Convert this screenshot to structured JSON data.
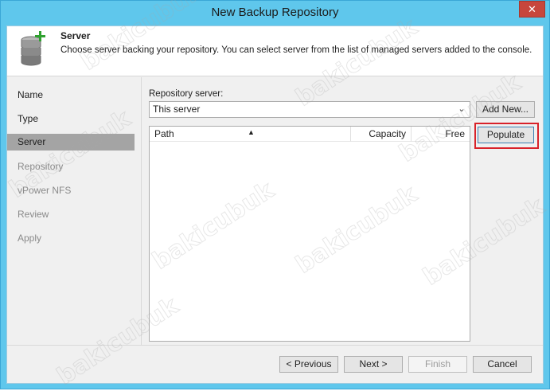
{
  "window": {
    "title": "New Backup Repository",
    "close_glyph": "✕"
  },
  "header": {
    "title": "Server",
    "description": "Choose server backing your repository. You can select server from the list of managed servers added to the console.",
    "icon": "database-add-icon"
  },
  "nav": {
    "items": [
      {
        "label": "Name",
        "state": "done"
      },
      {
        "label": "Type",
        "state": "done"
      },
      {
        "label": "Server",
        "state": "active"
      },
      {
        "label": "Repository",
        "state": "pending"
      },
      {
        "label": "vPower NFS",
        "state": "pending"
      },
      {
        "label": "Review",
        "state": "pending"
      },
      {
        "label": "Apply",
        "state": "pending"
      }
    ]
  },
  "main": {
    "repo_server_label": "Repository server:",
    "repo_server_value": "This server",
    "add_new_label": "Add New...",
    "populate_label": "Populate",
    "columns": [
      "Path",
      "Capacity",
      "Free"
    ]
  },
  "footer": {
    "previous_label": "< Previous",
    "next_label": "Next >",
    "finish_label": "Finish",
    "cancel_label": "Cancel"
  },
  "watermark": "bakicubuk",
  "colors": {
    "titlebar": "#5fc7ec",
    "close_button": "#c7463c",
    "nav_active": "#a4a4a4",
    "highlight": "#d8222a"
  }
}
